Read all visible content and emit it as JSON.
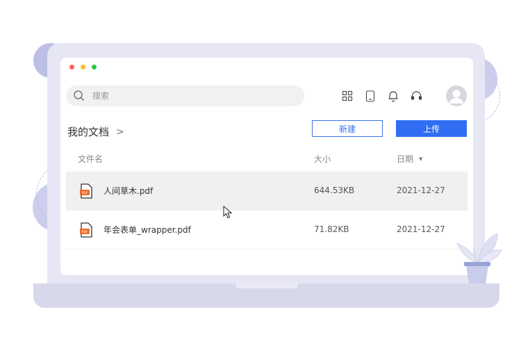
{
  "window": {
    "dots": [
      {
        "name": "close-dot",
        "color": "#ff5f57"
      },
      {
        "name": "minimize-dot",
        "color": "#febc2e"
      },
      {
        "name": "maximize-dot",
        "color": "#28c840"
      }
    ]
  },
  "search": {
    "placeholder": "搜索",
    "icon": "search-icon"
  },
  "toolbar": {
    "icons": [
      "grid-view-icon",
      "mobile-device-icon",
      "bell-icon",
      "headset-icon"
    ],
    "avatar_icon": "avatar-icon"
  },
  "breadcrumb": {
    "title": "我的文档",
    "separator": ">"
  },
  "actions": {
    "new_label": "新建",
    "upload_label": "上传"
  },
  "table": {
    "headers": {
      "name": "文件名",
      "size": "大小",
      "date": "日期",
      "sort_icon": "▼"
    },
    "rows": [
      {
        "name": "人间草木.pdf",
        "size": "644.53KB",
        "date": "2021-12-27",
        "icon": "pdf-file-icon"
      },
      {
        "name": "年会表单_wrapper.pdf",
        "size": "71.82KB",
        "date": "2021-12-27",
        "icon": "pdf-file-icon"
      }
    ]
  },
  "colors": {
    "accent": "#2f6ef2",
    "row_hover": "#f0f0f0",
    "laptop": "#e6e6f4",
    "pdf_icon": "#f06a2a"
  }
}
